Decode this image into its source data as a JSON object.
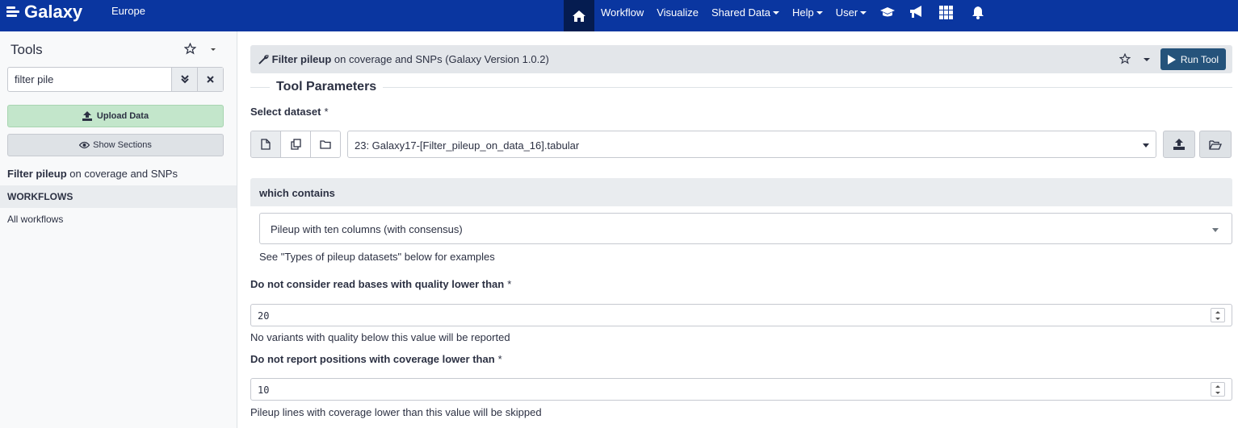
{
  "navbar": {
    "brand": "Galaxy",
    "region": "Europe",
    "items": [
      "Workflow",
      "Visualize",
      "Shared Data",
      "Help",
      "User"
    ]
  },
  "sidebar": {
    "title": "Tools",
    "search_value": "filter pile",
    "upload_label": "Upload Data",
    "sections_label": "Show Sections",
    "tool_name": "Filter pileup",
    "tool_desc": " on coverage and SNPs",
    "workflows_heading": "WORKFLOWS",
    "all_workflows": "All workflows"
  },
  "tool": {
    "name": "Filter pileup",
    "desc": " on coverage and SNPs (Galaxy Version 1.0.2)",
    "run_label": "Run Tool",
    "params_title": "Tool Parameters"
  },
  "form": {
    "dataset_label": "Select dataset",
    "dataset_value": "23: Galaxy17-[Filter_pileup_on_data_16].tabular",
    "contains_label": "which contains",
    "contains_value": "Pileup with ten columns (with consensus)",
    "contains_help": "See \"Types of pileup datasets\" below for examples",
    "quality_label": "Do not consider read bases with quality lower than",
    "quality_value": "20",
    "quality_help": "No variants with quality below this value will be reported",
    "coverage_label": "Do not report positions with coverage lower than",
    "coverage_value": "10",
    "coverage_help": "Pileup lines with coverage lower than this value will be skipped",
    "required_mark": "*"
  },
  "colors": {
    "navbar": "#0a36a0",
    "upload": "#c3e6cb",
    "run_button": "#25537b"
  }
}
